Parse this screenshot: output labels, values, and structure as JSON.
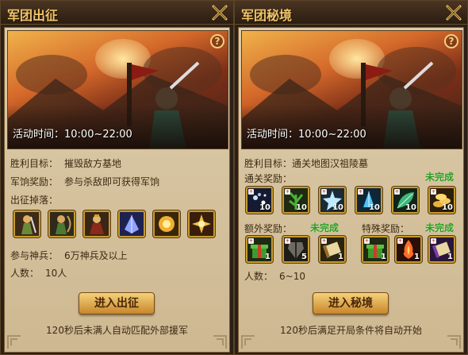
{
  "left": {
    "title": "军团出征",
    "activity_time": "活动时间：10:00~22:00",
    "victory_label": "胜利目标：",
    "victory_value": "摧毁敌方基地",
    "reward_label": "军饷奖励：",
    "reward_value": "参与杀敌即可获得军饷",
    "drops_label": "出征掉落：",
    "troops_label": "参与神兵：",
    "troops_value": "6万神兵及以上",
    "people_label": "人数：",
    "people_value": "10人",
    "button_label": "进入出征",
    "footnote": "120秒后未满人自动匹配外部援军",
    "drop_icons": [
      "warrior-figure-icon",
      "archer-figure-icon",
      "general-figure-icon",
      "crystal-shard-icon",
      "golden-orb-icon",
      "golden-burst-icon"
    ]
  },
  "right": {
    "title": "军团秘境",
    "activity_time": "活动时间：10:00~22:00",
    "victory_label": "胜利目标：",
    "victory_value": "通关地图汉祖陵墓",
    "clear_reward_label": "通关奖励：",
    "clear_reward_status": "未完成",
    "clear_items": [
      {
        "icon": "sparkle-gem-icon",
        "count": "10"
      },
      {
        "icon": "green-herb-icon",
        "count": "10"
      },
      {
        "icon": "silver-star-icon",
        "count": "10"
      },
      {
        "icon": "ice-crystal-icon",
        "count": "10"
      },
      {
        "icon": "jade-leaf-icon",
        "count": "10"
      },
      {
        "icon": "gold-coins-icon",
        "count": "10"
      }
    ],
    "extra_reward_label": "额外奖励：",
    "extra_reward_status": "未完成",
    "extra_items": [
      {
        "icon": "green-gift-box-icon",
        "count": "1"
      },
      {
        "icon": "armor-piece-icon",
        "count": "5"
      },
      {
        "icon": "scroll-item-icon",
        "count": "1"
      }
    ],
    "special_reward_label": "特殊奖励：",
    "special_reward_status": "未完成",
    "special_items": [
      {
        "icon": "green-gift-box-icon",
        "count": "1"
      },
      {
        "icon": "fire-crystal-icon",
        "count": "1"
      },
      {
        "icon": "purple-scroll-icon",
        "count": "1"
      }
    ],
    "people_label": "人数：",
    "people_value": "6~10",
    "button_label": "进入秘境",
    "footnote": "120秒后满足开局条件将自动开始"
  },
  "colors": {
    "title": "#f0c46a",
    "status_green": "#2c9a22",
    "slot_border": "#c79a2f",
    "parchment": "#d8c7a6"
  }
}
